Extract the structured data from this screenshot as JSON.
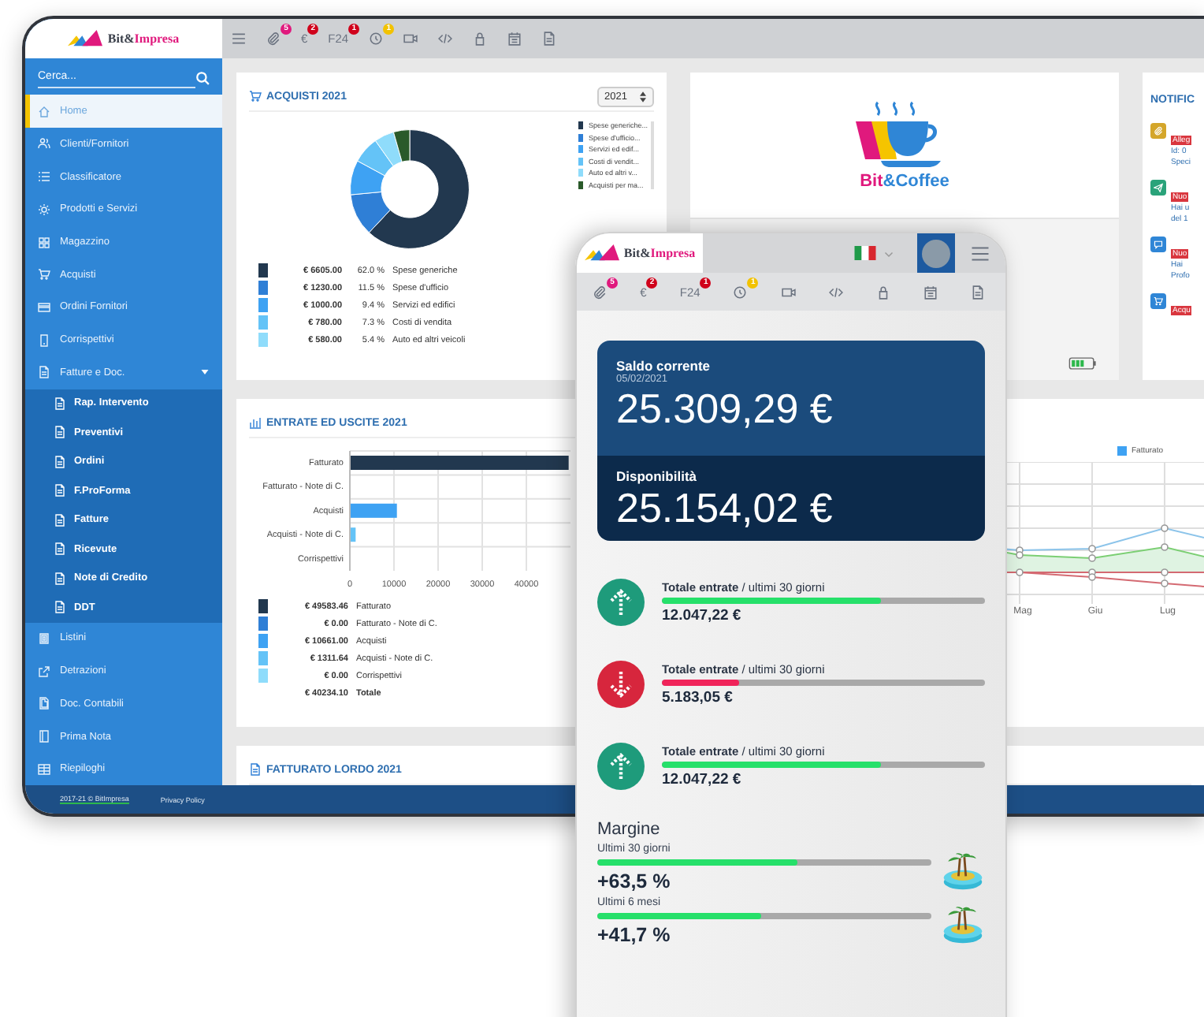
{
  "brand": {
    "part_1": "Bit&",
    "part_2": "Impresa"
  },
  "toolbar": [
    {
      "kind": "paperclip",
      "badge": "5",
      "color": "#e0197d"
    },
    {
      "kind": "euro",
      "label": "€",
      "badge": "2",
      "color": "#d0021b"
    },
    {
      "kind": "text",
      "label": "F24",
      "badge": "1",
      "color": "#d0021b"
    },
    {
      "kind": "clock",
      "badge": "1",
      "color": "#f2c200"
    },
    {
      "kind": "video"
    },
    {
      "kind": "code"
    },
    {
      "kind": "lock"
    },
    {
      "kind": "calendar"
    },
    {
      "kind": "document"
    }
  ],
  "sidebar": {
    "search": {
      "placeholder": "Cerca..."
    },
    "items": [
      {
        "kind": "home",
        "label": "Home",
        "selected": true
      },
      {
        "kind": "users",
        "label": "Clienti/Fornitori",
        "selected": false
      },
      {
        "kind": "list",
        "label": "Classificatore",
        "selected": false
      },
      {
        "kind": "gear",
        "label": "Prodotti e Servizi",
        "selected": false
      },
      {
        "kind": "grid",
        "label": "Magazzino",
        "selected": false
      },
      {
        "kind": "cart",
        "label": "Acquisti",
        "selected": false
      },
      {
        "kind": "card",
        "label": "Ordini Fornitori",
        "selected": false
      },
      {
        "kind": "phone",
        "label": "Corrispettivi",
        "selected": false
      },
      {
        "kind": "document",
        "label": "Fatture e Doc.",
        "selected": false,
        "expanded": true,
        "children": [
          {
            "label": "Rap. Intervento",
            "selected": false
          },
          {
            "label": "Preventivi",
            "selected": false
          },
          {
            "label": "Ordini",
            "selected": false
          },
          {
            "label": "F.ProForma",
            "selected": false
          },
          {
            "label": "Fatture",
            "selected": false
          },
          {
            "label": "Ricevute",
            "selected": false
          },
          {
            "label": "Note di Credito",
            "selected": false
          },
          {
            "label": "DDT",
            "selected": false
          }
        ]
      },
      {
        "kind": "block",
        "label": "Listini",
        "selected": false
      },
      {
        "kind": "export",
        "label": "Detrazioni",
        "selected": false
      },
      {
        "kind": "file",
        "label": "Doc. Contabili",
        "selected": false
      },
      {
        "kind": "notebook",
        "label": "Prima Nota",
        "selected": false
      },
      {
        "kind": "table",
        "label": "Riepiloghi",
        "selected": false
      }
    ]
  },
  "footer": {
    "copyright": "2017-21 © BitImpresa",
    "link": "Privacy Policy"
  },
  "purchases": {
    "title": "ACQUISTI 2021",
    "year": "2021",
    "chart_data": {
      "type": "donut",
      "categories": [
        "Spese generiche",
        "Spese d'ufficio",
        "Servizi ed edifici",
        "Costi di vendita",
        "Auto ed altri veicoli",
        "Acquisti per ma..."
      ],
      "values": [
        62.0,
        11.5,
        9.4,
        7.3,
        5.4,
        4.4
      ]
    },
    "legend": [
      {
        "amount": "€ 6605.00",
        "percent": "62.0 %",
        "color": "#22384f"
      },
      {
        "amount": "€ 1230.00",
        "percent": "11.5 %",
        "color": "#2f7fd6"
      },
      {
        "amount": "€ 1000.00",
        "percent": "9.4 %",
        "color": "#3ea2f3"
      },
      {
        "amount": "€ 780.00",
        "percent": "7.3 %",
        "color": "#64c3f7"
      },
      {
        "amount": "€ 580.00",
        "percent": "5.4 %",
        "color": "#8fdcfb"
      }
    ],
    "side_legend": [
      {
        "label": "Spese generiche...",
        "color": "#22384f"
      },
      {
        "label": "Spese d'ufficio...",
        "color": "#2f7fd6"
      },
      {
        "label": "Servizi ed edif...",
        "color": "#3ea2f3"
      },
      {
        "label": "Costi di vendit...",
        "color": "#64c3f7"
      },
      {
        "label": "Auto ed altri v...",
        "color": "#8fdcfb"
      },
      {
        "color": "#2a5a2a"
      }
    ]
  },
  "coffee": {
    "part_1": "Bit",
    "part_2": "&Coffee"
  },
  "notifications": {
    "title": "NOTIFIC",
    "items": [
      {
        "kind": "paperclip",
        "color": "#d4a62a",
        "badge": "Alleg",
        "lines": [
          "Id: 0",
          "Speci"
        ]
      },
      {
        "kind": "send",
        "color": "#2aa37a",
        "badge": "Nuo",
        "lines": [
          "Hai u",
          "del 1"
        ]
      },
      {
        "kind": "chat",
        "color": "#2f86d6",
        "badge": "Nuo",
        "lines": [
          "Hai",
          "Profo"
        ]
      },
      {
        "kind": "cart",
        "color": "#2f86d6",
        "badge": "Acqu"
      }
    ]
  },
  "income_expenses": {
    "title": "ENTRATE ED USCITE 2021",
    "chart_data": {
      "type": "bar",
      "orientation": "horizontal",
      "categories": [
        "Fatturato",
        "Fatturato - Note di C.",
        "Acquisti",
        "Acquisti - Note di C.",
        "Corrispettivi"
      ],
      "values": [
        49583.46,
        0,
        10661,
        1311.64,
        0
      ],
      "xticks": [
        0,
        10000,
        20000,
        30000,
        40000
      ],
      "xlim": [
        0,
        50000
      ],
      "grid": true
    },
    "legend": [
      {
        "amount": "€ 49583.46",
        "label": "Fatturato",
        "color": "#22384f"
      },
      {
        "amount": "€ 0.00",
        "label": "Fatturato - Note di C.",
        "color": "#2f7fd6"
      },
      {
        "amount": "€ 10661.00",
        "label": "Acquisti",
        "color": "#3ea2f3"
      },
      {
        "amount": "€ 1311.64",
        "label": "Acquisti - Note di C.",
        "color": "#64c3f7"
      },
      {
        "amount": "€ 0.00",
        "label": "Corrispettivi",
        "color": "#8fdcfb"
      }
    ],
    "total": {
      "amount": "€ 40234.10",
      "label": "Totale"
    }
  },
  "trend": {
    "legend": "Fatturato",
    "months": [
      "Mag",
      "Giu",
      "Lug"
    ]
  },
  "gross": {
    "title": "FATTURATO LORDO 2021"
  },
  "mobile": {
    "brand": {
      "part_1": "Bit&",
      "part_2": "Impresa"
    },
    "toolbar": [
      {
        "kind": "paperclip",
        "badge": "5",
        "color": "#e0197d"
      },
      {
        "kind": "euro",
        "label": "€",
        "badge": "2",
        "color": "#d0021b"
      },
      {
        "kind": "text",
        "label": "F24",
        "badge": "1",
        "color": "#d0021b"
      },
      {
        "kind": "clock",
        "badge": "1",
        "color": "#f2c200"
      },
      {
        "kind": "video"
      },
      {
        "kind": "code"
      },
      {
        "kind": "lock"
      },
      {
        "kind": "calendar"
      },
      {
        "kind": "document"
      }
    ],
    "balance": {
      "title": "Saldo corrente",
      "date": "05/02/2021",
      "amount": "25.309,29 €"
    },
    "available": {
      "title": "Disponibilità",
      "amount": "25.154,02 €"
    },
    "totals": [
      {
        "kind": "in",
        "label": "**Totale entrate** / ultimi 30 giorni",
        "level": 0.68,
        "amount": "12.047,22 €"
      },
      {
        "kind": "out",
        "label": "**Totale entrate** / ultimi 30 giorni",
        "level": 0.24,
        "amount": "5.183,05 €"
      },
      {
        "kind": "in",
        "label": "**Totale entrate** / ultimi 30 giorni",
        "level": 0.68,
        "amount": "12.047,22 €"
      }
    ],
    "margin": {
      "title": "Margine",
      "items": [
        {
          "label": "Ultimi 30 giorni",
          "level": 0.6,
          "value": "+63,5 %"
        },
        {
          "label": "Ultimi 6 mesi",
          "level": 0.49,
          "value": "+41,7 %"
        }
      ]
    }
  }
}
